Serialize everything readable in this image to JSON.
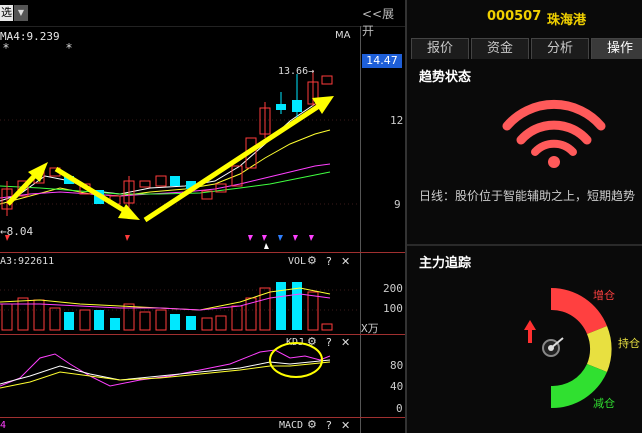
{
  "toolbar": {
    "mode_label": "选",
    "dropdown_glyph": "▼",
    "expand_label": "<<展开"
  },
  "main_chart": {
    "ma_legend": "MA4:9.239",
    "ma_button": "MA",
    "stars": [
      "*",
      "*"
    ],
    "current_price_tag": "14.47",
    "high_label": "13.66→",
    "low_label": "←8.04",
    "axis": [
      "12",
      "9"
    ]
  },
  "volume_panel": {
    "legend": "A3:922611",
    "title": "VOL",
    "axis": [
      "200",
      "100"
    ],
    "unit": "X万"
  },
  "kdj_panel": {
    "title": "KDJ",
    "axis": [
      "80",
      "40",
      "0"
    ]
  },
  "macd_panel": {
    "legend": "4",
    "title": "MACD"
  },
  "panel_controls": {
    "gear": "⚙",
    "help": "?",
    "close": "✕"
  },
  "stock": {
    "code": "000507",
    "name": "珠海港"
  },
  "tabs": [
    {
      "label": "报价",
      "active": false
    },
    {
      "label": "资金",
      "active": false
    },
    {
      "label": "分析",
      "active": false
    },
    {
      "label": "操作",
      "active": true
    }
  ],
  "trend": {
    "title": "趋势状态",
    "description": "日线：股价位于智能辅助之上，短期趋势",
    "signal_color": "#ff5a5a"
  },
  "main_force": {
    "title": "主力追踪",
    "labels": {
      "increase": "增仓",
      "hold": "持仓",
      "decrease": "减仓"
    },
    "colors": {
      "increase": "#ff4040",
      "hold": "#e8e040",
      "decrease": "#30e030"
    }
  },
  "colors": {
    "up": "#ff3b3b",
    "down": "#00e8ff",
    "ma_white": "#ffffff",
    "ma_yellow": "#ffff30",
    "ma_magenta": "#ff40ff",
    "ma_green": "#40ff40",
    "annotation": "#ffff00"
  }
}
